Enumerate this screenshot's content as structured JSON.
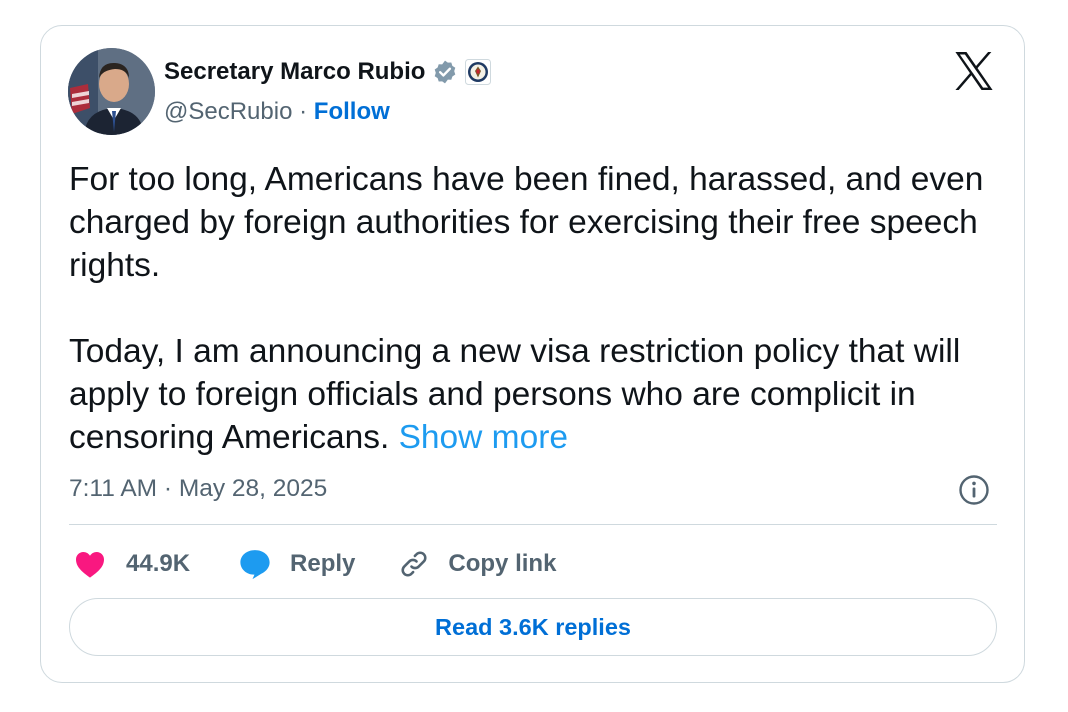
{
  "author": {
    "name": "Secretary Marco Rubio",
    "handle": "@SecRubio",
    "separator": "·",
    "follow_label": "Follow",
    "verified_badge_icon": "verified-gray-badge-icon",
    "affiliation_icon": "department-of-state-seal-icon"
  },
  "brand": {
    "logo_icon": "x-logo-icon"
  },
  "tweet": {
    "paragraph_1": "For too long, Americans have been fined, harassed, and even charged by foreign authorities for exercising their free speech rights.",
    "paragraph_2": "Today, I am announcing a new visa restriction policy that will apply to foreign officials and persons who are complicit in censoring Americans.",
    "show_more_label": "Show more",
    "timestamp": "7:11 AM · May 28, 2025"
  },
  "actions": {
    "like_count": "44.9K",
    "reply_label": "Reply",
    "copy_link_label": "Copy link"
  },
  "read_replies_label": "Read 3.6K replies",
  "colors": {
    "link_blue": "#1d9bf0",
    "follow_blue": "#006fd6",
    "like_pink": "#f91880",
    "reply_blue": "#1d9bf0",
    "secondary_text": "#536471",
    "border": "#cfd9de"
  }
}
